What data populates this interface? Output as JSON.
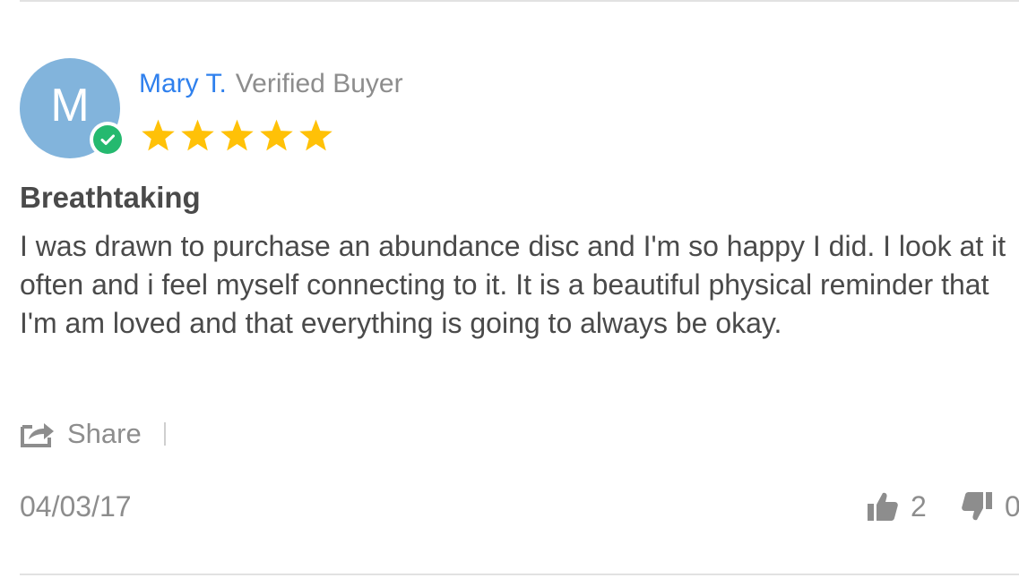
{
  "review": {
    "avatar_letter": "M",
    "reviewer_name": "Mary T.",
    "buyer_tag": "Verified Buyer",
    "rating": 5,
    "rating_max": 5,
    "title": "Breathtaking",
    "body": "I was drawn to purchase an abundance disc and I'm so happy I did. I look at it often and i feel myself connecting to it. It is a beautiful physical reminder that I'm am loved and that everything is going to always be okay.",
    "date": "04/03/17"
  },
  "actions": {
    "share_label": "Share",
    "thumbs_up_count": "2",
    "thumbs_down_count": "0"
  },
  "icons": {
    "verified": "check-circle-icon",
    "star": "star-icon",
    "share": "share-icon",
    "thumbs_up": "thumbs-up-icon",
    "thumbs_down": "thumbs-down-icon"
  },
  "colors": {
    "avatar_bg": "#82b4dc",
    "verified_badge": "#25b96f",
    "name_link": "#2f80ed",
    "star_fill": "#ffc107",
    "muted_text": "#8d8d8d",
    "body_text": "#4a4a4a"
  }
}
